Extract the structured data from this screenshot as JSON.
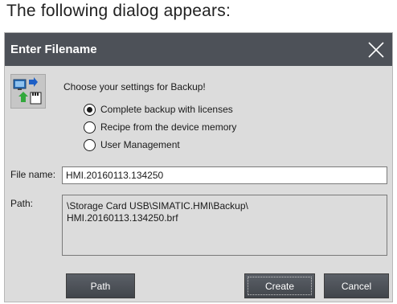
{
  "caption": "The following dialog appears:",
  "dialog": {
    "title": "Enter Filename",
    "prompt": "Choose your settings for Backup!",
    "options": [
      {
        "label": "Complete backup with licenses",
        "checked": true
      },
      {
        "label": "Recipe from the device memory",
        "checked": false
      },
      {
        "label": "User Management",
        "checked": false
      }
    ],
    "file_name_label": "File name:",
    "file_name_value": "HMI.20160113.134250",
    "path_label": "Path:",
    "path_line1": "\\Storage Card USB\\SIMATIC.HMI\\Backup\\",
    "path_line2": "HMI.20160113.134250.brf",
    "buttons": {
      "path": "Path",
      "create": "Create",
      "cancel": "Cancel"
    }
  }
}
